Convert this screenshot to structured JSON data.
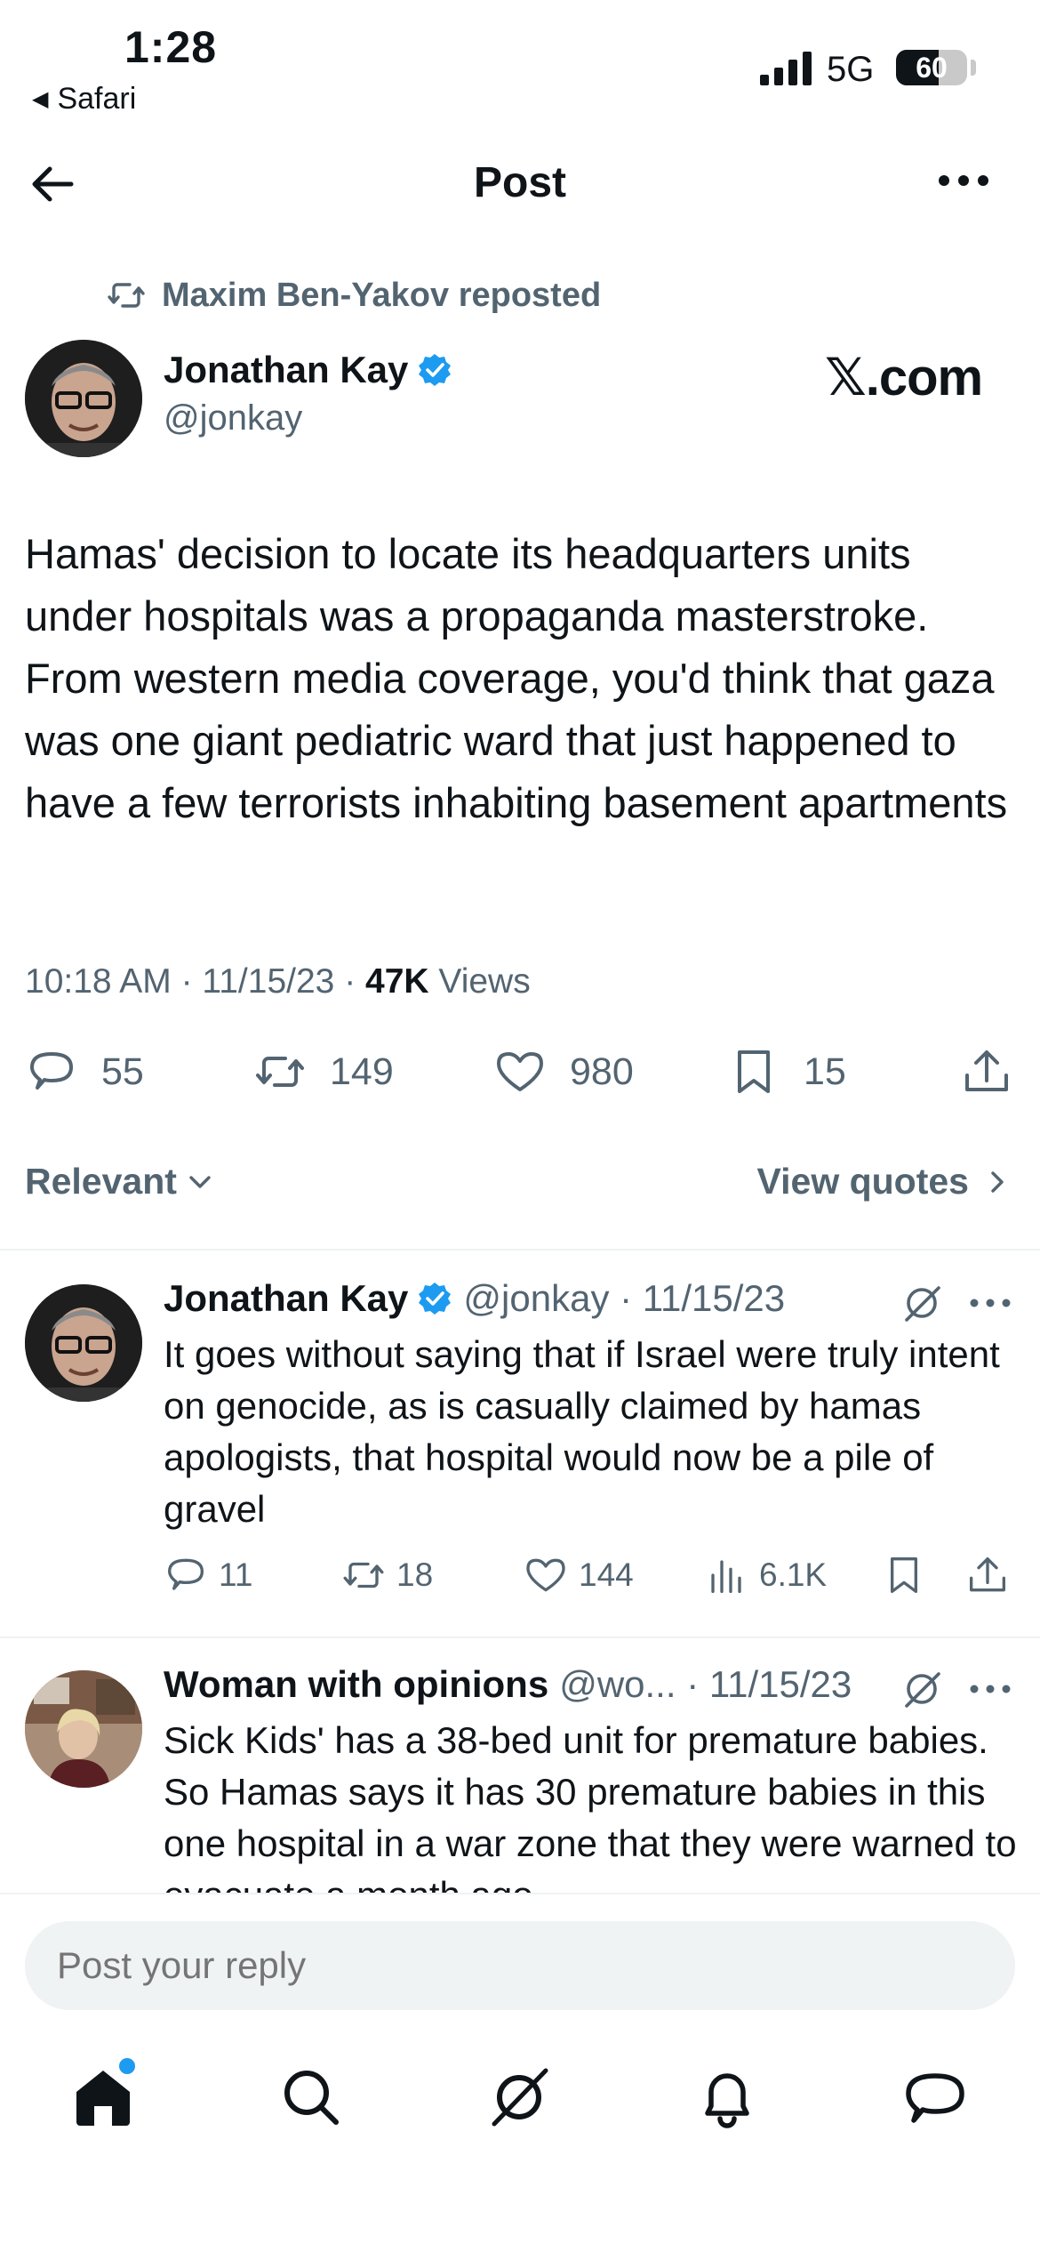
{
  "status_bar": {
    "time": "1:28",
    "back_app": "Safari",
    "network": "5G",
    "battery": "60",
    "battery_level": 0.6
  },
  "header": {
    "title": "Post"
  },
  "post": {
    "repost_text": "Maxim Ben-Yakov reposted",
    "author_name": "Jonathan Kay",
    "author_handle": "@jonkay",
    "watermark": "𝕏.com",
    "text": "Hamas' decision to locate its headquarters units under hospitals was a propaganda masterstroke. From western media coverage, you'd think that gaza was one giant pediatric ward that just happened to have a few terrorists inhabiting basement apartments",
    "timestamp": "10:18 AM · 11/15/23 · ",
    "views_count": "47K",
    "views_label": " Views",
    "stats": {
      "replies": "55",
      "reposts": "149",
      "likes": "980",
      "bookmarks": "15"
    }
  },
  "filter": {
    "sort": "Relevant",
    "view_quotes": "View quotes"
  },
  "replies": [
    {
      "name": "Jonathan Kay",
      "meta": "@jonkay · 11/15/23",
      "text": "It goes without saying that if Israel were truly intent on genocide, as is casually claimed by hamas apologists, that hospital would now be a pile of gravel",
      "replies": "11",
      "reposts": "18",
      "likes": "144",
      "views": "6.1K"
    },
    {
      "name": "Woman with opinions",
      "meta": "@wo... · 11/15/23",
      "text": "Sick Kids' has a 38-bed unit for premature babies.  So Hamas says it has 30 premature babies in this one hospital in a war zone that they were warned to evacuate a month ago"
    }
  ],
  "composer": {
    "placeholder": "Post your reply"
  },
  "colors": {
    "accent": "#1d9bf0",
    "secondary_text": "#536471",
    "divider": "#eff3f4"
  }
}
